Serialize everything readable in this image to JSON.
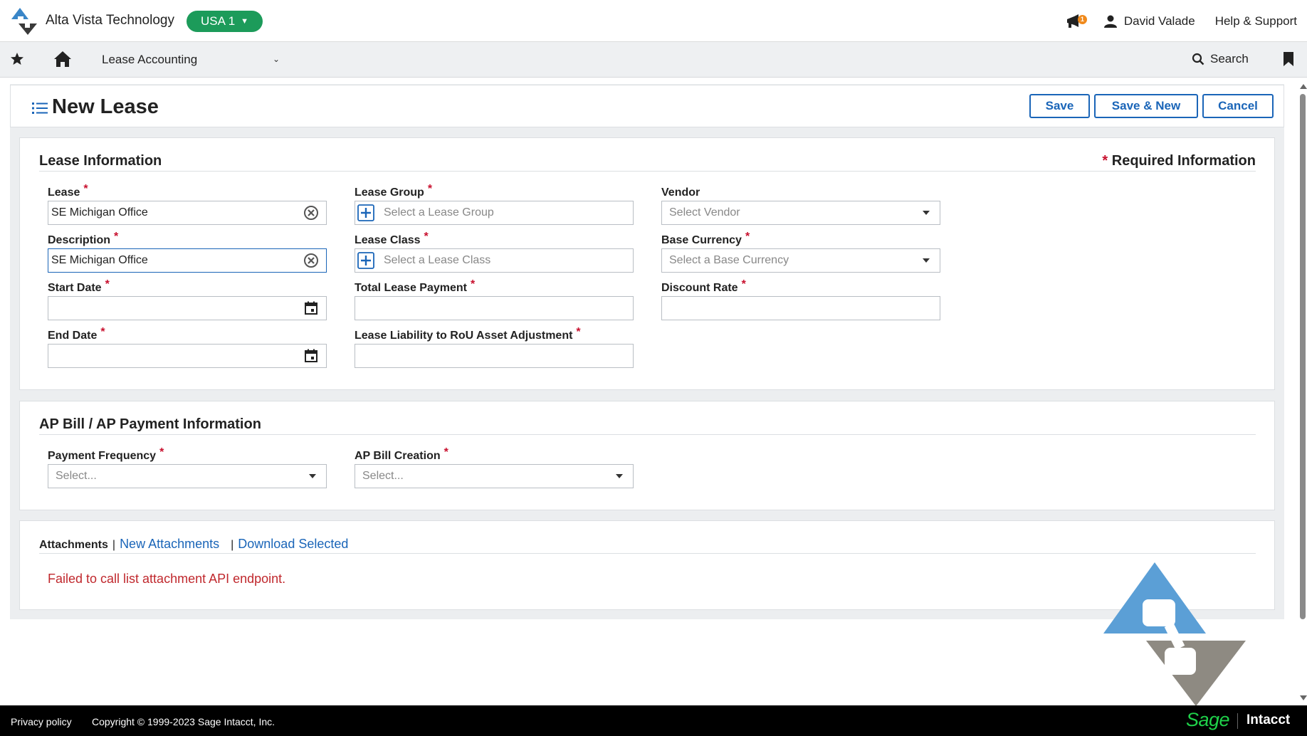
{
  "header": {
    "company": "Alta Vista Technology",
    "entity": "USA 1",
    "notification_count": "1",
    "user_name": "David Valade",
    "help_label": "Help & Support"
  },
  "nav": {
    "module": "Lease Accounting",
    "search_label": "Search"
  },
  "page": {
    "title": "New Lease",
    "save_label": "Save",
    "save_new_label": "Save & New",
    "cancel_label": "Cancel"
  },
  "lease_info": {
    "title": "Lease Information",
    "required_label": "Required Information",
    "lease": {
      "label": "Lease",
      "value": "SE Michigan Office"
    },
    "description": {
      "label": "Description",
      "value": "SE Michigan Office"
    },
    "start_date": {
      "label": "Start Date",
      "value": ""
    },
    "end_date": {
      "label": "End Date",
      "value": ""
    },
    "lease_group": {
      "label": "Lease Group",
      "placeholder": "Select a Lease Group"
    },
    "lease_class": {
      "label": "Lease Class",
      "placeholder": "Select a Lease Class"
    },
    "total_payment": {
      "label": "Total Lease Payment",
      "value": ""
    },
    "liability_adjustment": {
      "label": "Lease Liability to RoU Asset Adjustment",
      "value": ""
    },
    "vendor": {
      "label": "Vendor",
      "placeholder": "Select Vendor"
    },
    "base_currency": {
      "label": "Base Currency",
      "placeholder": "Select a Base Currency"
    },
    "discount_rate": {
      "label": "Discount Rate",
      "value": ""
    }
  },
  "ap_info": {
    "title": "AP Bill / AP Payment Information",
    "payment_frequency": {
      "label": "Payment Frequency",
      "placeholder": "Select..."
    },
    "ap_bill_creation": {
      "label": "AP Bill Creation",
      "placeholder": "Select..."
    }
  },
  "attachments": {
    "tab_label": "Attachments",
    "new_label": "New Attachments",
    "download_label": "Download Selected",
    "error": "Failed to call list attachment API endpoint."
  },
  "footer": {
    "privacy": "Privacy policy",
    "copyright": "Copyright © 1999-2023 Sage Intacct, Inc.",
    "brand_sage": "Sage",
    "brand_intacct": "Intacct"
  },
  "colors": {
    "accent": "#1a65b8",
    "entity_pill": "#1c9b5a",
    "required": "#c8102e",
    "error": "#c0282d",
    "footer_sage": "#1fd14a"
  },
  "icons": [
    "logo-icon",
    "chevron-down-icon",
    "megaphone-icon",
    "user-icon",
    "star-icon",
    "home-icon",
    "search-icon",
    "bookmark-icon",
    "list-icon",
    "clear-icon",
    "calendar-icon",
    "plus-icon",
    "caret-down-icon"
  ]
}
